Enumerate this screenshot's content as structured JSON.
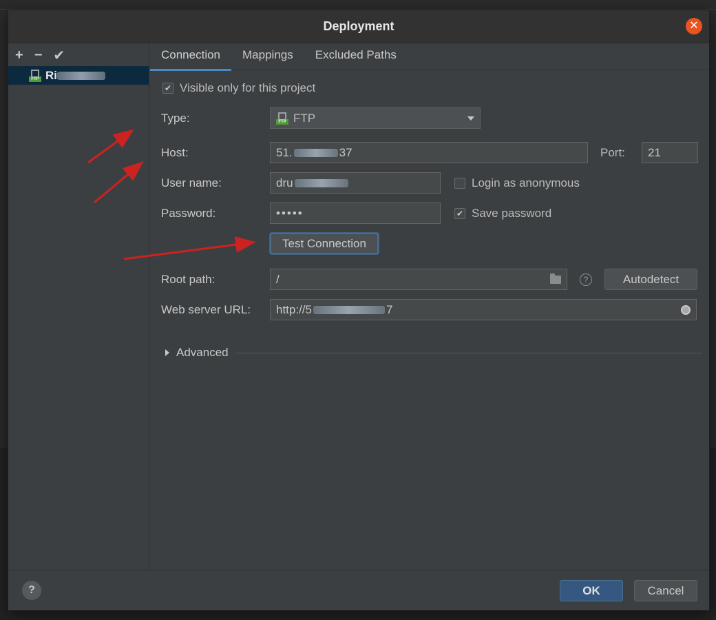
{
  "dialog": {
    "title": "Deployment"
  },
  "left_toolbar": {
    "add": "+",
    "remove": "−",
    "apply": "✔"
  },
  "server": {
    "name_prefix": "Ri",
    "icon": "ftp-server-icon"
  },
  "tabs": [
    {
      "label": "Connection"
    },
    {
      "label": "Mappings"
    },
    {
      "label": "Excluded Paths"
    }
  ],
  "connection": {
    "visible_only_label": "Visible only for this project",
    "visible_only_checked": true,
    "type_label": "Type:",
    "type_value": "FTP",
    "host_label": "Host:",
    "host_prefix": "51.",
    "host_suffix": "37",
    "port_label": "Port:",
    "port_value": "21",
    "username_label": "User name:",
    "username_prefix": "dru",
    "anonymous_label": "Login as anonymous",
    "anonymous_checked": false,
    "password_label": "Password:",
    "password_value": "•••••",
    "save_password_label": "Save password",
    "save_password_checked": true,
    "test_connection_label": "Test Connection",
    "root_path_label": "Root path:",
    "root_path_value": "/",
    "autodetect_label": "Autodetect",
    "web_url_label": "Web server URL:",
    "web_url_prefix": "http://5",
    "web_url_suffix": "7",
    "advanced_label": "Advanced"
  },
  "footer": {
    "help": "?",
    "ok_label": "OK",
    "cancel_label": "Cancel"
  },
  "colors": {
    "dialog_bg": "#3c3f41",
    "selection": "#0d293e",
    "accent": "#4a88c7",
    "ok_button": "#365880",
    "close_button": "#e95420",
    "annotation_arrow": "#cc2222"
  }
}
